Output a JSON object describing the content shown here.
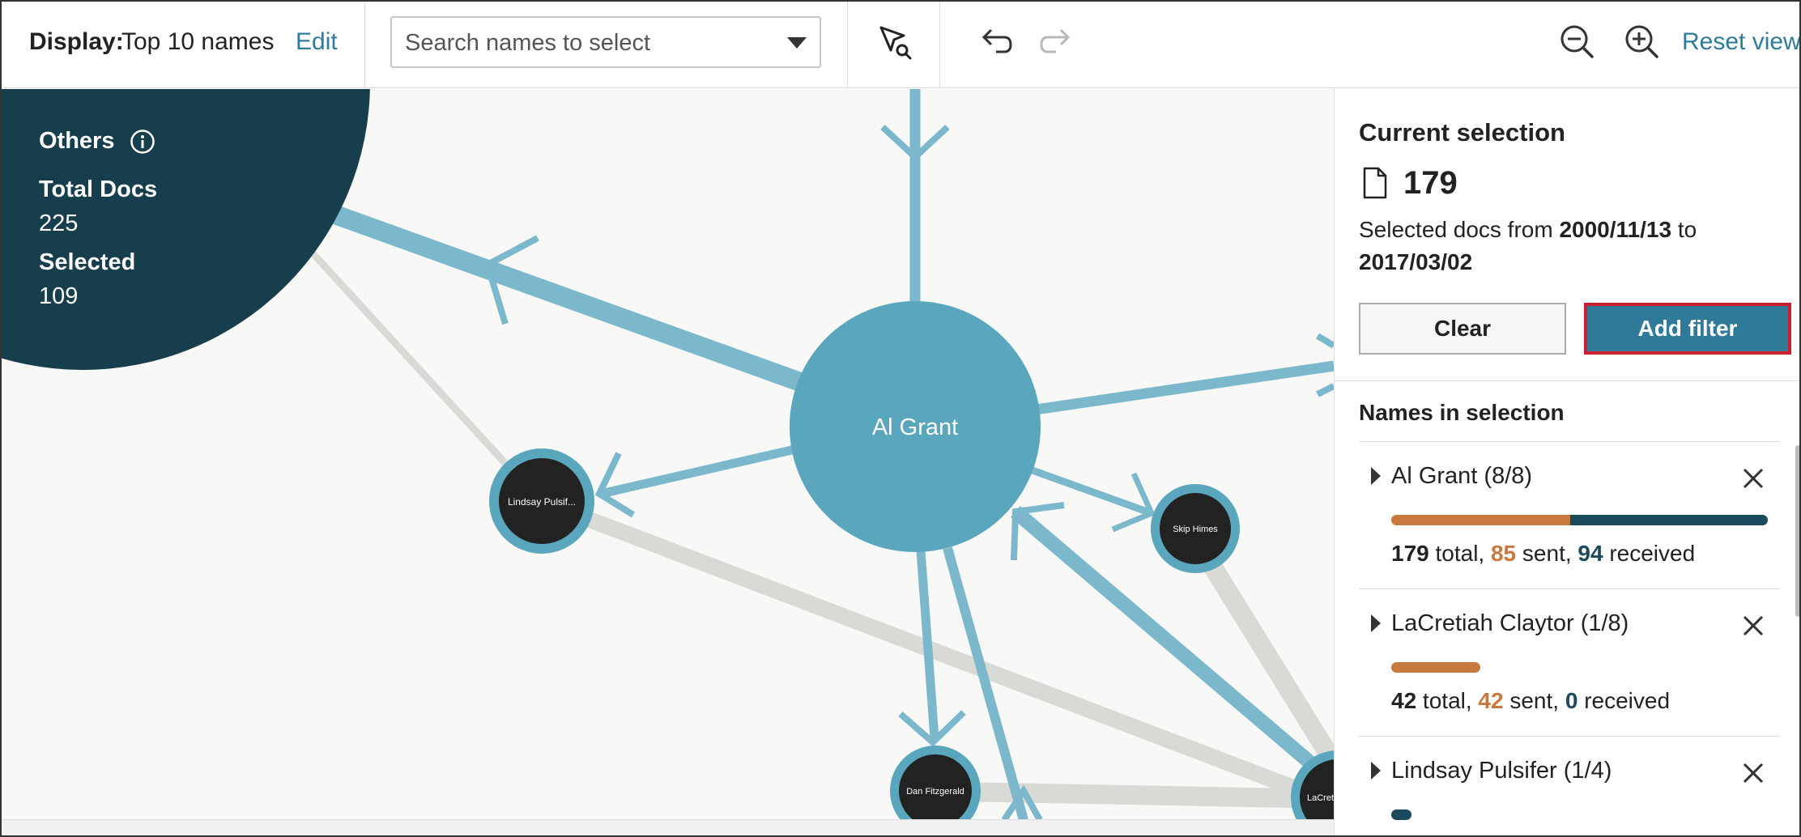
{
  "toolbar": {
    "display_label": "Display:",
    "display_value": "Top 10 names",
    "edit_label": "Edit",
    "search_placeholder": "Search names to select",
    "icons": [
      "select-search-icon",
      "undo-icon",
      "redo-icon",
      "zoom-out-icon",
      "zoom-in-icon"
    ],
    "reset_view_label": "Reset view"
  },
  "graph": {
    "others": {
      "title": "Others",
      "total_docs_label": "Total Docs",
      "total_docs_value": "225",
      "selected_label": "Selected",
      "selected_value": "109"
    },
    "center_node": "Al Grant",
    "nodes": [
      "Lindsay Pulsif...",
      "Skip Himes",
      "Dan Fitzgerald",
      "LaCret"
    ],
    "colors": {
      "edge_blue": "#7bb8cc",
      "edge_grey": "#d9d9d5",
      "center_node": "#5aa6bd",
      "node_dark": "#222222",
      "others_bg": "#173e4c"
    }
  },
  "panel": {
    "current_selection_title": "Current selection",
    "doc_count": "179",
    "range_prefix": "Selected docs from",
    "range_from": "2000/11/13",
    "range_mid": "to",
    "range_to": "2017/03/02",
    "clear_label": "Clear",
    "add_filter_label": "Add filter",
    "names_title": "Names in selection",
    "names": [
      {
        "label": "Al Grant (8/8)",
        "total": "179",
        "sent": "85",
        "received": "94",
        "sent_fraction": 0.475,
        "total_word": " total, ",
        "sent_word": " sent, ",
        "received_word": " received"
      },
      {
        "label": "LaCretiah Claytor (1/8)",
        "total": "42",
        "sent": "42",
        "received": "0",
        "sent_fraction": 1.0,
        "total_word": " total, ",
        "sent_word": " sent, ",
        "received_word": " received"
      },
      {
        "label": "Lindsay Pulsifer (1/4)"
      }
    ],
    "colors": {
      "sent": "#c87a3e",
      "received": "#1b4a5c",
      "accent": "#2f7a99"
    }
  }
}
